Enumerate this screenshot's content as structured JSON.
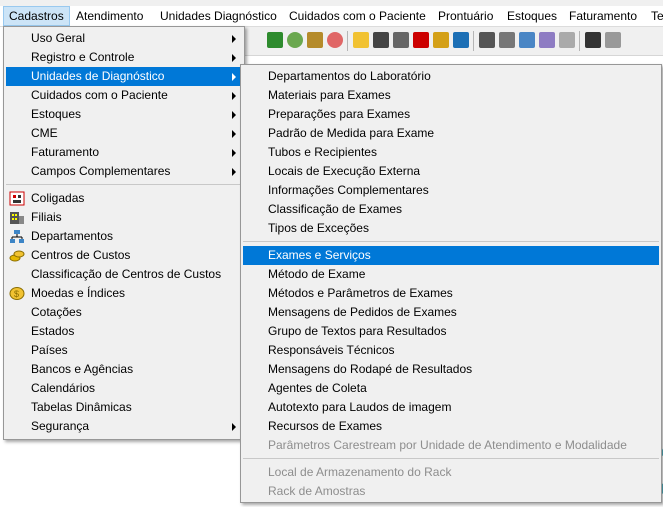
{
  "menubar": {
    "items": [
      {
        "label": "Cadastros"
      },
      {
        "label": "Atendimento"
      },
      {
        "label": "Unidades Diagnóstico"
      },
      {
        "label": "Cuidados com o Paciente"
      },
      {
        "label": "Prontuário"
      },
      {
        "label": "Estoques"
      },
      {
        "label": "Faturamento"
      },
      {
        "label": "Te"
      }
    ]
  },
  "cadastros_menu": {
    "items": [
      {
        "label": "Uso Geral"
      },
      {
        "label": "Registro e Controle"
      },
      {
        "label": "Unidades de Diagnóstico"
      },
      {
        "label": "Cuidados com o Paciente"
      },
      {
        "label": "Estoques"
      },
      {
        "label": "CME"
      },
      {
        "label": "Faturamento"
      },
      {
        "label": "Campos Complementares"
      },
      {
        "label": "Coligadas",
        "icon": "company-icon"
      },
      {
        "label": "Filiais",
        "icon": "building-icon"
      },
      {
        "label": "Departamentos",
        "icon": "org-chart-icon"
      },
      {
        "label": "Centros de Custos",
        "icon": "coins-icon"
      },
      {
        "label": "Classificação de Centros de Custos"
      },
      {
        "label": "Moedas e Índices",
        "icon": "coin-icon"
      },
      {
        "label": "Cotações"
      },
      {
        "label": "Estados"
      },
      {
        "label": "Países"
      },
      {
        "label": "Bancos e Agências"
      },
      {
        "label": "Calendários"
      },
      {
        "label": "Tabelas Dinâmicas"
      },
      {
        "label": "Segurança"
      }
    ]
  },
  "diagnostico_submenu": {
    "items": [
      {
        "label": "Departamentos do Laboratório"
      },
      {
        "label": "Materiais para Exames"
      },
      {
        "label": "Preparações para Exames"
      },
      {
        "label": "Padrão de Medida para Exame"
      },
      {
        "label": "Tubos e Recipientes"
      },
      {
        "label": "Locais de Execução Externa"
      },
      {
        "label": "Informações Complementares"
      },
      {
        "label": "Classificação de Exames"
      },
      {
        "label": "Tipos de Exceções"
      },
      {
        "label": "Exames e Serviços"
      },
      {
        "label": "Método de Exame"
      },
      {
        "label": "Métodos e Parâmetros de Exames"
      },
      {
        "label": "Mensagens de Pedidos de Exames"
      },
      {
        "label": "Grupo de Textos para Resultados"
      },
      {
        "label": "Responsáveis Técnicos"
      },
      {
        "label": "Mensagens do Rodapé de Resultados"
      },
      {
        "label": "Agentes de Coleta"
      },
      {
        "label": "Autotexto para Laudos de imagem"
      },
      {
        "label": "Recursos de Exames"
      },
      {
        "label": "Parâmetros Carestream por Unidade de Atendimento e Modalidade"
      },
      {
        "label": "Local de Armazenamento do Rack"
      },
      {
        "label": "Rack de Amostras"
      }
    ]
  },
  "colors": {
    "highlight": "#0078d7",
    "menubar_active": "#cce4f7",
    "disabled_text": "#8d8d8d",
    "menu_bg": "#f0f0f0"
  }
}
